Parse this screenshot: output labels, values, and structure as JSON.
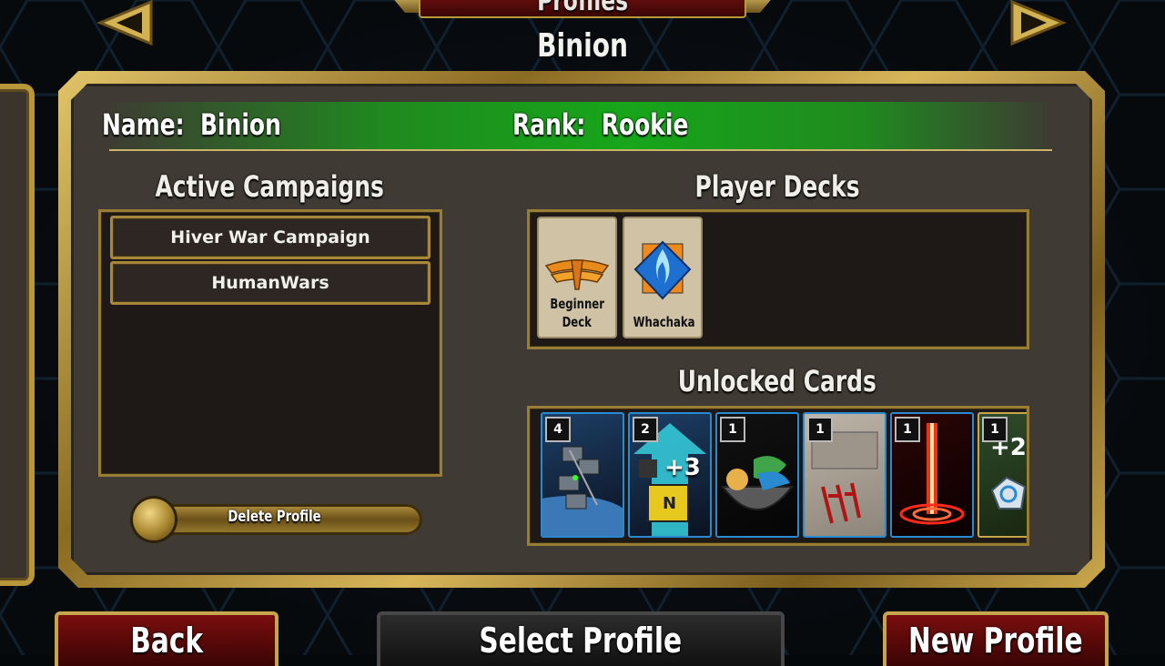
{
  "header": {
    "screen_title": "Profiles",
    "profile_name": "Binion"
  },
  "profile": {
    "name_label": "Name:",
    "name_value": "Binion",
    "rank_label": "Rank:",
    "rank_value": "Rookie"
  },
  "campaigns": {
    "title": "Active Campaigns",
    "items": [
      "Hiver War Campaign",
      "HumanWars"
    ]
  },
  "decks": {
    "title": "Player Decks",
    "items": [
      {
        "line1": "Beginner",
        "line2": "Deck"
      },
      {
        "line1": "Whachaka",
        "line2": ""
      }
    ]
  },
  "unlocked": {
    "title": "Unlocked Cards",
    "counts": [
      "4",
      "2",
      "1",
      "1",
      "1",
      "1"
    ],
    "card2_text": "+3",
    "card6_text": "+2"
  },
  "buttons": {
    "delete": "Delete Profile",
    "back": "Back",
    "select": "Select Profile",
    "new": "New Profile"
  },
  "colors": {
    "gold": "#c6a54d",
    "rank_bar_green": "#17a61a",
    "button_red": "#7a0e0e"
  }
}
